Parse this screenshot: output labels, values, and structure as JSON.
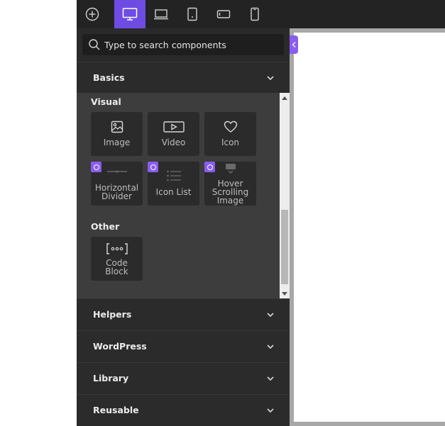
{
  "toolbar": {
    "items": [
      {
        "icon": "add-circle-icon"
      },
      {
        "icon": "desktop-icon",
        "active": true
      },
      {
        "icon": "laptop-icon"
      },
      {
        "icon": "tablet-icon"
      },
      {
        "icon": "tablet-landscape-icon"
      },
      {
        "icon": "mobile-icon"
      }
    ],
    "accent_color": "#6e4ce4"
  },
  "search": {
    "placeholder": "Type to search components"
  },
  "sections": {
    "basics": "Basics",
    "helpers": "Helpers",
    "wordpress": "WordPress",
    "library": "Library",
    "reusable": "Reusable"
  },
  "basics": {
    "visual_title": "Visual",
    "other_title": "Other",
    "visual_items": [
      {
        "label": "Image",
        "icon": "image-icon",
        "pro": false
      },
      {
        "label": "Video",
        "icon": "video-icon",
        "pro": false
      },
      {
        "label": "Icon",
        "icon": "heart-icon",
        "pro": false
      },
      {
        "label_line1": "Horizontal",
        "label_line2": "Divider",
        "icon": "divider-icon",
        "pro": true
      },
      {
        "label": "Icon List",
        "icon": "list-icon",
        "pro": true
      },
      {
        "label_line1": "Hover",
        "label_line2": "Scrolling",
        "label_line3": "Image",
        "icon": "scrolling-image-icon",
        "pro": true
      }
    ],
    "other_items": [
      {
        "label_line1": "Code",
        "label_line2": "Block",
        "icon": "code-block-icon",
        "pro": false
      }
    ]
  },
  "colors": {
    "badge": "#8a5cf0",
    "panel_bg": "#2a2a2a",
    "content_bg": "#3d3d3d"
  }
}
